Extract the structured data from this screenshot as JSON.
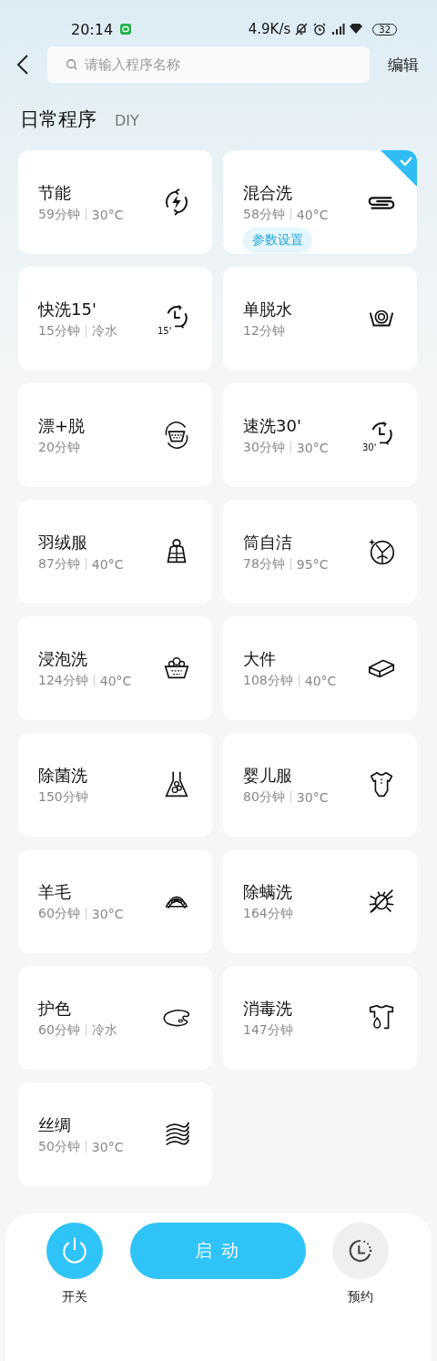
{
  "status_bar": {
    "time": "20:14",
    "speed": "4.9K/s",
    "battery": "32"
  },
  "header": {
    "search": {
      "placeholder": "请输入程序名称"
    },
    "edit": "编辑"
  },
  "section": {
    "title": "日常程序",
    "tab": "DIY"
  },
  "settings_label": "参数设置",
  "programs": [
    {
      "name": "节能",
      "duration": "59分钟",
      "temp": "30°C",
      "kind": "energy",
      "selected": false
    },
    {
      "name": "混合洗",
      "duration": "58分钟",
      "temp": "40°C",
      "kind": "mixed",
      "selected": true
    },
    {
      "name": "快洗15'",
      "duration": "15分钟",
      "temp": "冷水",
      "kind": "timer",
      "icon_text": "15'",
      "selected": false
    },
    {
      "name": "单脱水",
      "duration": "12分钟",
      "kind": "spin",
      "selected": false
    },
    {
      "name": "漂+脱",
      "duration": "20分钟",
      "kind": "rinse",
      "selected": false
    },
    {
      "name": "速洗30'",
      "duration": "30分钟",
      "temp": "30°C",
      "kind": "timer",
      "icon_text": "30'",
      "selected": false
    },
    {
      "name": "羽绒服",
      "duration": "87分钟",
      "temp": "40°C",
      "kind": "jacket",
      "selected": false
    },
    {
      "name": "筒自洁",
      "duration": "78分钟",
      "temp": "95°C",
      "kind": "drum",
      "selected": false
    },
    {
      "name": "浸泡洗",
      "duration": "124分钟",
      "temp": "40°C",
      "kind": "soak",
      "selected": false
    },
    {
      "name": "大件",
      "duration": "108分钟",
      "temp": "40°C",
      "kind": "bulky",
      "selected": false
    },
    {
      "name": "除菌洗",
      "duration": "150分钟",
      "kind": "flask",
      "selected": false
    },
    {
      "name": "婴儿服",
      "duration": "80分钟",
      "temp": "30°C",
      "kind": "baby",
      "selected": false
    },
    {
      "name": "羊毛",
      "duration": "60分钟",
      "temp": "30°C",
      "kind": "wool",
      "selected": false
    },
    {
      "name": "除螨洗",
      "duration": "164分钟",
      "kind": "mite",
      "selected": false
    },
    {
      "name": "护色",
      "duration": "60分钟",
      "temp": "冷水",
      "kind": "palette",
      "selected": false
    },
    {
      "name": "消毒洗",
      "duration": "147分钟",
      "kind": "shirt",
      "selected": false
    },
    {
      "name": "丝绸",
      "duration": "50分钟",
      "temp": "30°C",
      "kind": "silk",
      "selected": false
    }
  ],
  "bottom_bar": {
    "power": "开关",
    "start": "启 动",
    "schedule": "预约"
  }
}
